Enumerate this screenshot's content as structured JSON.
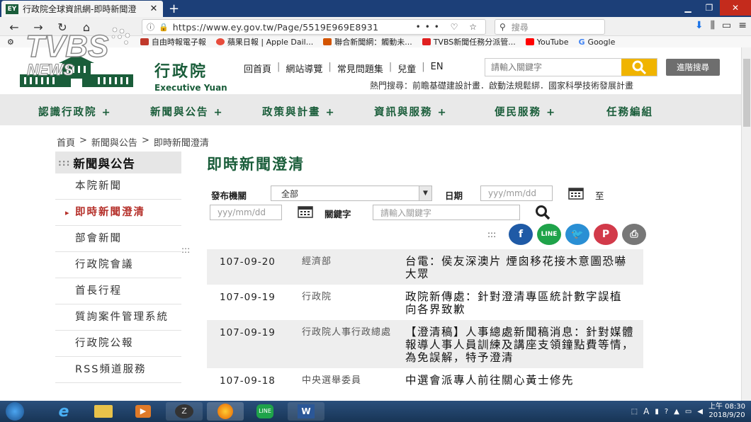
{
  "browser": {
    "tab_title": "行政院全球資訊網-即時新聞澄",
    "tab_favicon": "EY",
    "url": "https://www.ey.gov.tw/Page/5519E969E8931",
    "search_placeholder": "搜尋",
    "bookmarks": [
      {
        "label": "自由時報電子報",
        "color": "#c0392b"
      },
      {
        "label": "蘋果日報 | Apple Dail...",
        "color": "#e74c3c"
      },
      {
        "label": "聯合新聞網：觸動未...",
        "color": "#d35400"
      },
      {
        "label": "TVBS新聞任務分派管...",
        "color": "#e02020"
      },
      {
        "label": "YouTube",
        "color": "#ff0000"
      },
      {
        "label": "Google",
        "color": "#4285f4"
      }
    ]
  },
  "watermark": {
    "text": "TVBS NEWS"
  },
  "site": {
    "logo_zh": "行政院",
    "logo_en": "Executive Yuan",
    "top_links": [
      "回首頁",
      "網站導覽",
      "常見問題集",
      "兒童",
      "EN"
    ],
    "search_placeholder": "請輸入關鍵字",
    "advanced_search": "進階搜尋",
    "hot_search": "熱門搜尋：前瞻基礎建設計畫．啟動法規鬆綁．國家科學技術發展計畫",
    "main_nav": [
      "認識行政院 +",
      "新聞與公告 +",
      "政策與計畫 +",
      "資訊與服務 +",
      "便民服務 +",
      "任務編組"
    ]
  },
  "breadcrumb": [
    "首頁",
    ">",
    "新聞與公告",
    ">",
    "即時新聞澄清"
  ],
  "sidebar": {
    "heading": "新聞與公告",
    "items": [
      "本院新聞",
      "即時新聞澄清",
      "部會新聞",
      "行政院會議",
      "首長行程",
      "質詢案件管理系統",
      "行政院公報",
      "RSS頻道服務"
    ]
  },
  "content": {
    "title": "即時新聞澄清",
    "filters": {
      "org_label": "發布機關",
      "org_value": "全部",
      "date_label": "日期",
      "date_placeholder": "yyy/mm/dd",
      "to_label": "至",
      "keyword_label": "關鍵字",
      "keyword_placeholder": "請輸入關鍵字"
    },
    "news": [
      {
        "date": "107-09-20",
        "org": "經濟部",
        "title": "台電：侯友深澳片 煙囪移花接木意圖恐嚇大眾"
      },
      {
        "date": "107-09-19",
        "org": "行政院",
        "title": "政院新傳處：針對澄清專區統計數字誤植 向各界致歉"
      },
      {
        "date": "107-09-19",
        "org": "行政院人事行政總處",
        "title": "【澄清稿】人事總處新聞稿消息：針對媒體報導人事人員訓練及講座支領鐘點費等情，為免誤解，特予澄清"
      },
      {
        "date": "107-09-18",
        "org": "中央選舉委員",
        "title": "中選會派專人前往關心黃士修先"
      }
    ]
  },
  "taskbar": {
    "clock_time": "上午 08:30",
    "clock_date": "2018/9/20",
    "ime": "A"
  }
}
